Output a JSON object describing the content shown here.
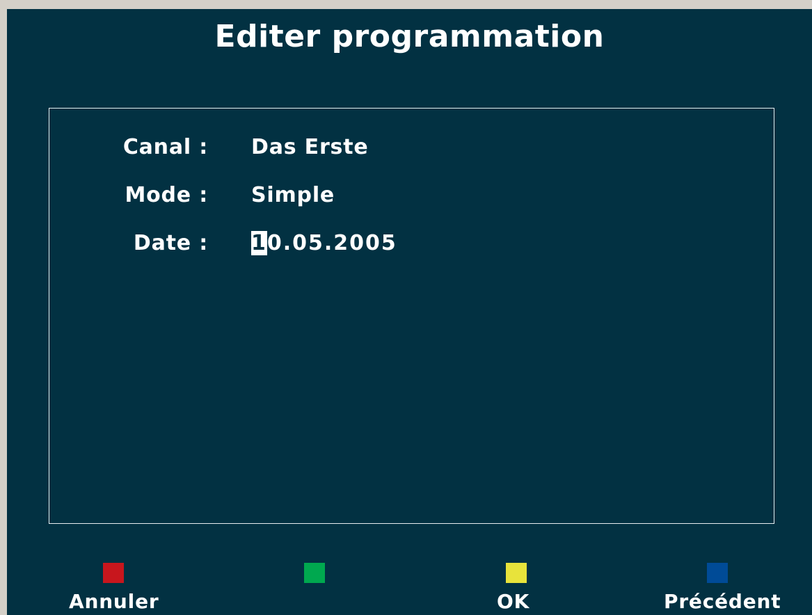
{
  "title": "Editer programmation",
  "fields": {
    "canal": {
      "label": "Canal :",
      "value": "Das Erste"
    },
    "mode": {
      "label": "Mode :",
      "value": "Simple"
    },
    "date": {
      "label": "Date :",
      "value_cursor_char": "1",
      "value_rest": "0.05.2005"
    }
  },
  "footer": {
    "red": {
      "label": "Annuler",
      "color": "#c8161d"
    },
    "green": {
      "label": "",
      "color": "#00a84f"
    },
    "yellow": {
      "label": "OK",
      "color": "#e8e33b"
    },
    "blue": {
      "label": "Précédent",
      "color": "#004b97"
    }
  }
}
